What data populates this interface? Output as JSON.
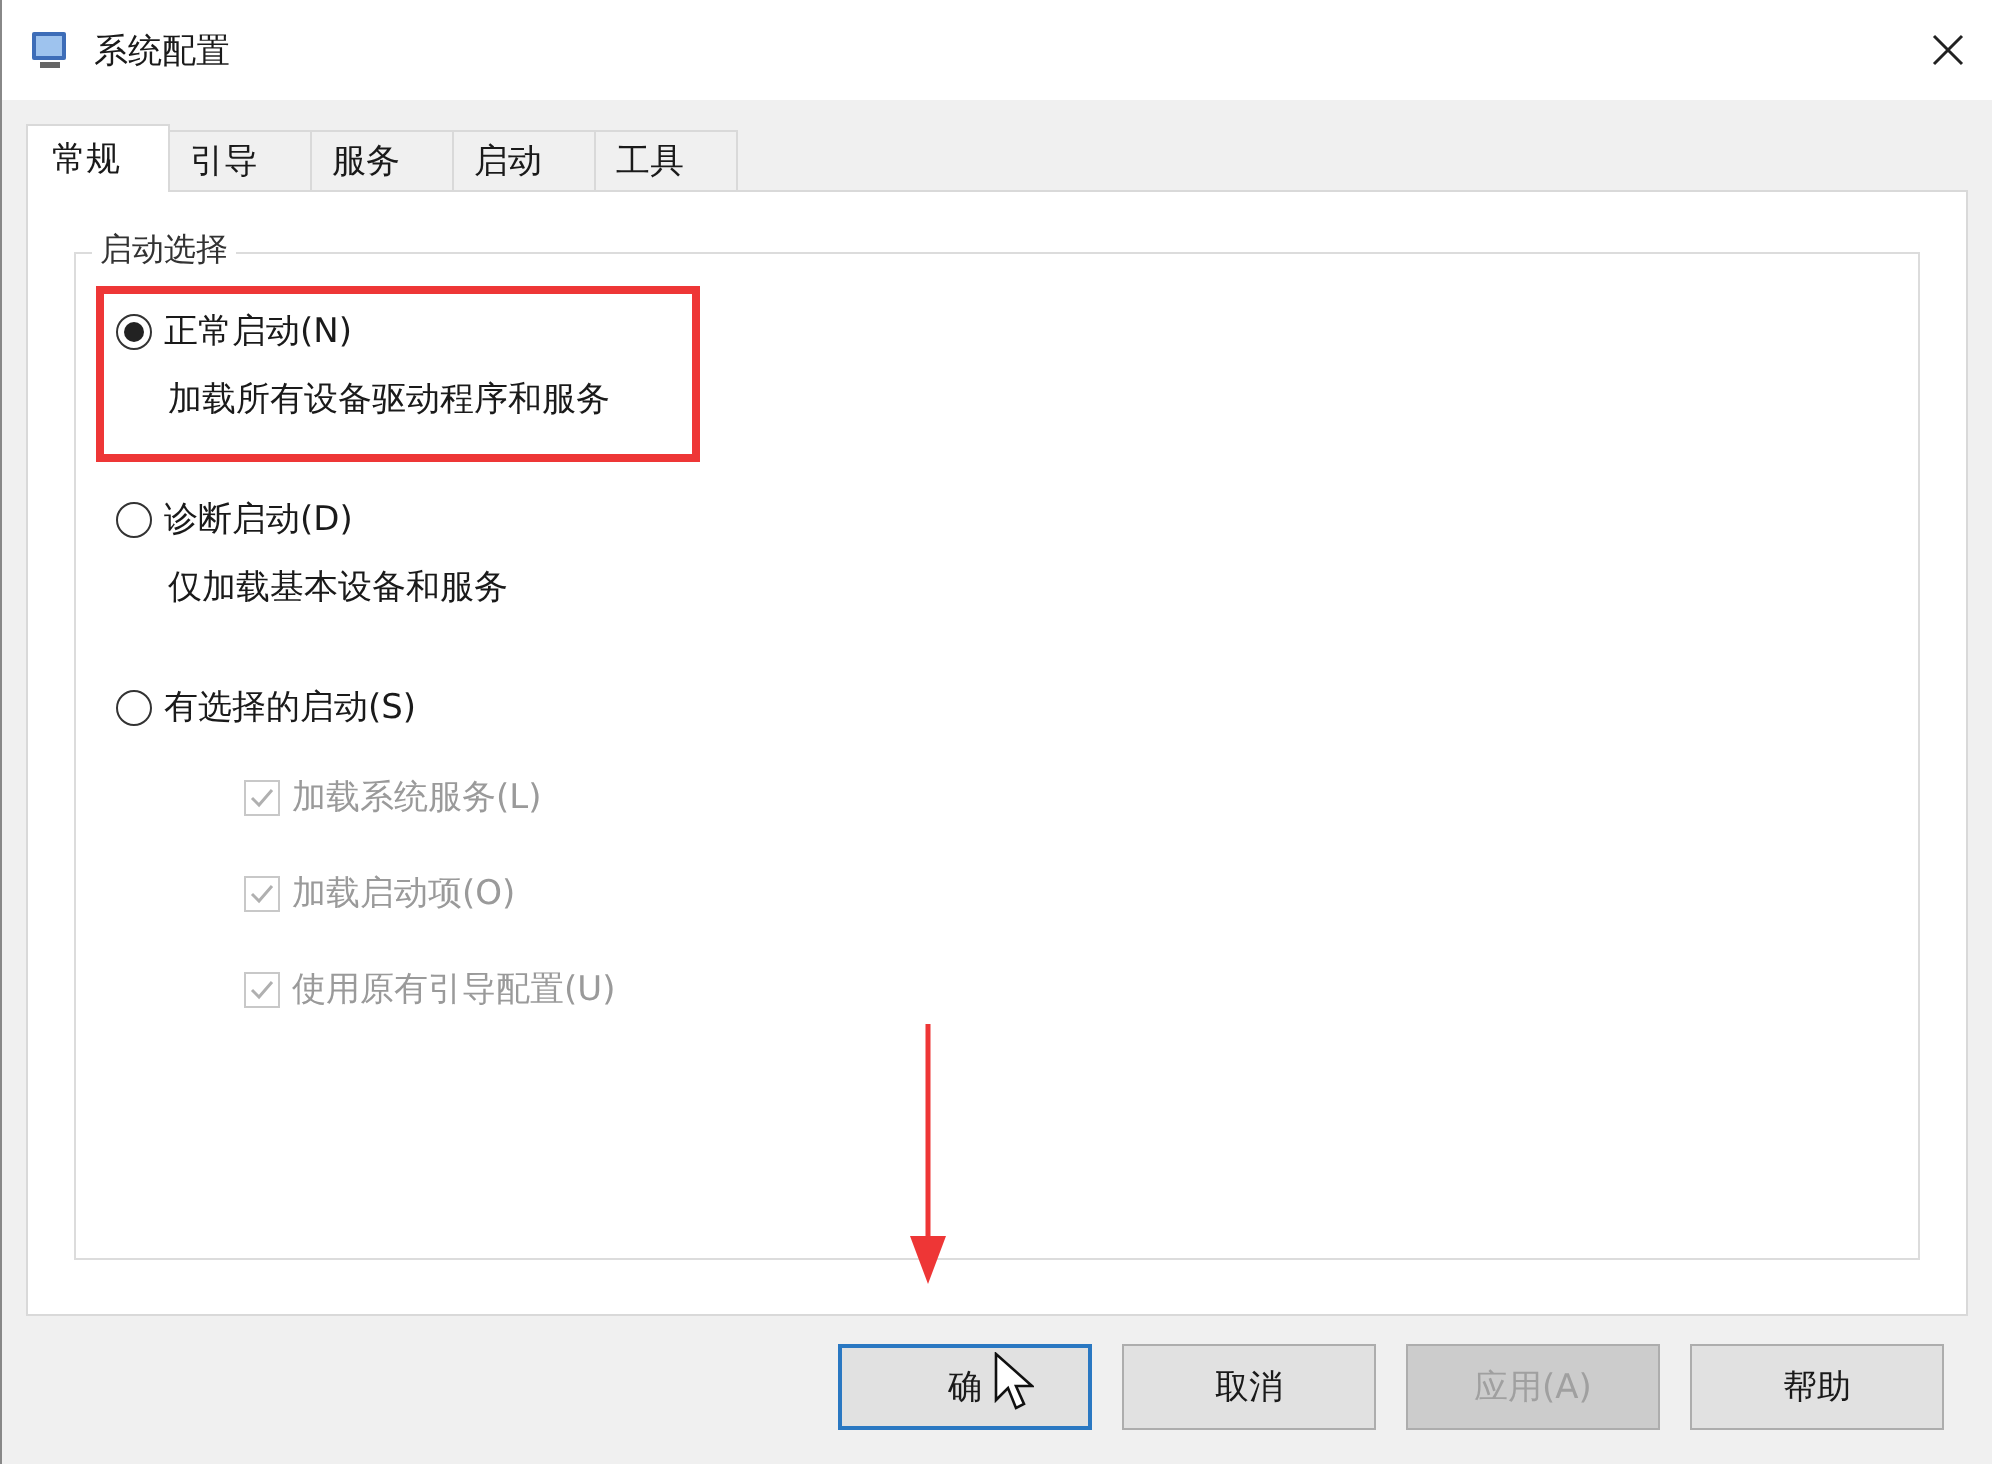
{
  "window": {
    "title": "系统配置"
  },
  "tabs": [
    {
      "label": "常规",
      "selected": true
    },
    {
      "label": "引导",
      "selected": false
    },
    {
      "label": "服务",
      "selected": false
    },
    {
      "label": "启动",
      "selected": false
    },
    {
      "label": "工具",
      "selected": false
    }
  ],
  "group": {
    "label": "启动选择",
    "options": [
      {
        "label": "正常启动(N)",
        "description": "加载所有设备驱动程序和服务",
        "selected": true,
        "highlighted": true
      },
      {
        "label": "诊断启动(D)",
        "description": "仅加载基本设备和服务",
        "selected": false,
        "highlighted": false
      },
      {
        "label": "有选择的启动(S)",
        "selected": false,
        "highlighted": false,
        "children": [
          {
            "label": "加载系统服务(L)",
            "checked": true,
            "disabled": true
          },
          {
            "label": "加载启动项(O)",
            "checked": true,
            "disabled": true
          },
          {
            "label": "使用原有引导配置(U)",
            "checked": true,
            "disabled": true
          }
        ]
      }
    ]
  },
  "buttons": [
    {
      "label": "确",
      "focused": true,
      "disabled": false
    },
    {
      "label": "取消",
      "focused": false,
      "disabled": false
    },
    {
      "label": "应用(A)",
      "focused": false,
      "disabled": true
    },
    {
      "label": "帮助",
      "focused": false,
      "disabled": false
    }
  ]
}
